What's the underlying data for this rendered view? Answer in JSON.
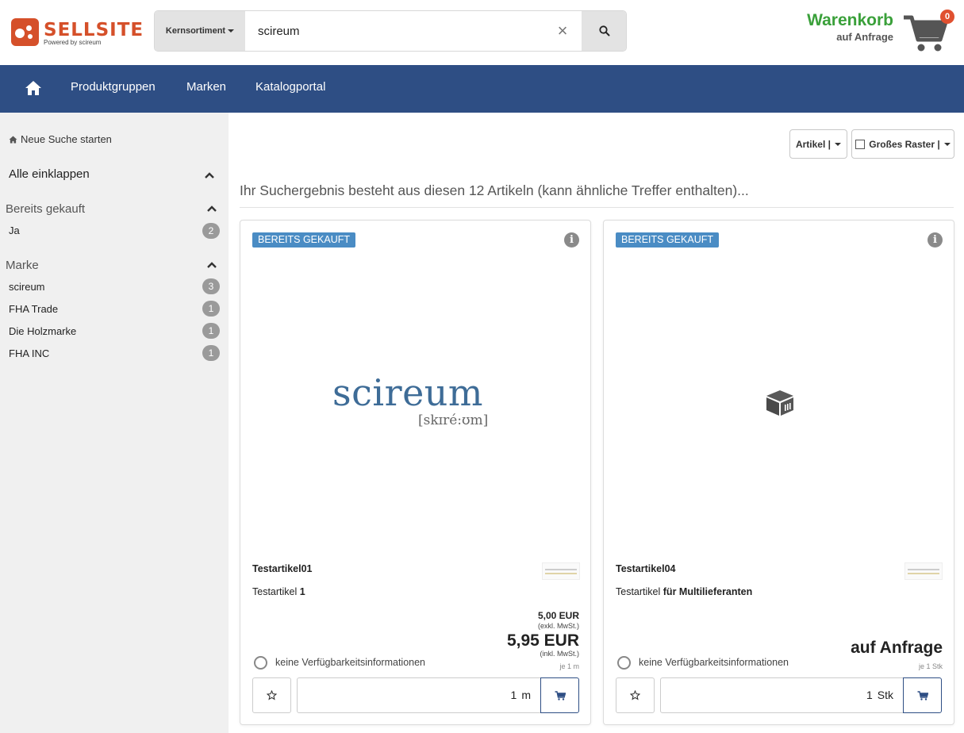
{
  "header": {
    "logo_text": "SELLSITE",
    "logo_sub": "Powered by scireum",
    "search_category": "Kernsortiment",
    "search_value": "scireum",
    "cart_title": "Warenkorb",
    "cart_sub": "auf Anfrage",
    "cart_count": "0"
  },
  "nav": {
    "items": [
      {
        "label": "Produktgruppen"
      },
      {
        "label": "Marken"
      },
      {
        "label": "Katalogportal"
      }
    ]
  },
  "sidebar": {
    "new_search": "Neue Suche starten",
    "collapse_all": "Alle einklappen",
    "facets": [
      {
        "title": "Bereits gekauft",
        "items": [
          {
            "label": "Ja",
            "count": "2"
          }
        ]
      },
      {
        "title": "Marke",
        "items": [
          {
            "label": "scireum",
            "count": "3"
          },
          {
            "label": "FHA Trade",
            "count": "1"
          },
          {
            "label": "Die Holzmarke",
            "count": "1"
          },
          {
            "label": "FHA INC",
            "count": "1"
          }
        ]
      }
    ]
  },
  "main": {
    "view_dropdown": "Artikel |",
    "grid_dropdown": "Großes Raster |",
    "result_text": "Ihr Suchergebnis besteht aus diesen 12 Artikeln (kann ähnliche Treffer enthalten)...",
    "products": [
      {
        "badge": "BEREITS GEKAUFT",
        "brand_logo": "scireum",
        "brand_logo_sub": "[skɪré:ʊm]",
        "name": "Testartikel01",
        "desc_prefix": "Testartikel",
        "desc_bold": "1",
        "price_net": "5,00 EUR",
        "price_net_note": "(exkl. MwSt.)",
        "price_gross": "5,95 EUR",
        "price_gross_note": "(inkl. MwSt.)",
        "unit_note": "je 1 m",
        "availability": "keine Verfügbarkeitsinformationen",
        "qty": "1",
        "qty_unit": "m"
      },
      {
        "badge": "BEREITS GEKAUFT",
        "name": "Testartikel04",
        "desc_prefix": "Testartikel",
        "desc_bold": "für Multilieferanten",
        "price": "auf Anfrage",
        "unit_note": "je 1 Stk",
        "availability": "keine Verfügbarkeitsinformationen",
        "qty": "1",
        "qty_unit": "Stk"
      }
    ]
  },
  "colors": {
    "nav": "#2e4e84",
    "brand": "#d5502a",
    "cart": "#3aa03a",
    "badge": "#4a8cc4"
  }
}
